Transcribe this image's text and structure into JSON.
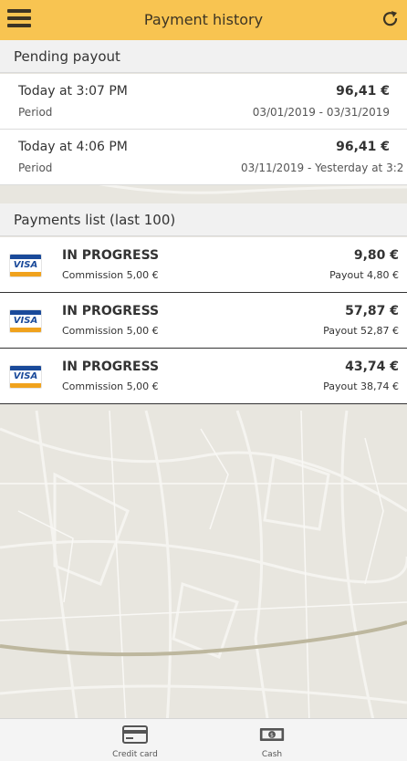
{
  "header": {
    "title": "Payment history",
    "accent_color": "#f8c451",
    "menu_icon": "hamburger-menu-icon",
    "refresh_icon": "refresh-icon"
  },
  "pending": {
    "title": "Pending payout",
    "rows": [
      {
        "time": "Today at 3:07 PM",
        "label": "Period",
        "amount": "96,41 €",
        "range": "03/01/2019 - 03/31/2019"
      },
      {
        "time": "Today at 4:06 PM",
        "label": "Period",
        "amount": "96,41 €",
        "range": "03/11/2019 - Yesterday at 3:2"
      }
    ]
  },
  "payments": {
    "title": "Payments list (last 100)",
    "card_brand": "VISA",
    "rows": [
      {
        "status": "IN PROGRESS",
        "commission": "Commission 5,00 €",
        "amount": "9,80 €",
        "payout": "Payout 4,80 €"
      },
      {
        "status": "IN PROGRESS",
        "commission": "Commission 5,00 €",
        "amount": "57,87 €",
        "payout": "Payout 52,87 €"
      },
      {
        "status": "IN PROGRESS",
        "commission": "Commission 5,00 €",
        "amount": "43,74 €",
        "payout": "Payout 38,74 €"
      }
    ]
  },
  "tabs": {
    "credit_card": {
      "label": "Credit card",
      "icon": "credit-card-icon"
    },
    "cash": {
      "label": "Cash",
      "icon": "cash-icon"
    }
  }
}
